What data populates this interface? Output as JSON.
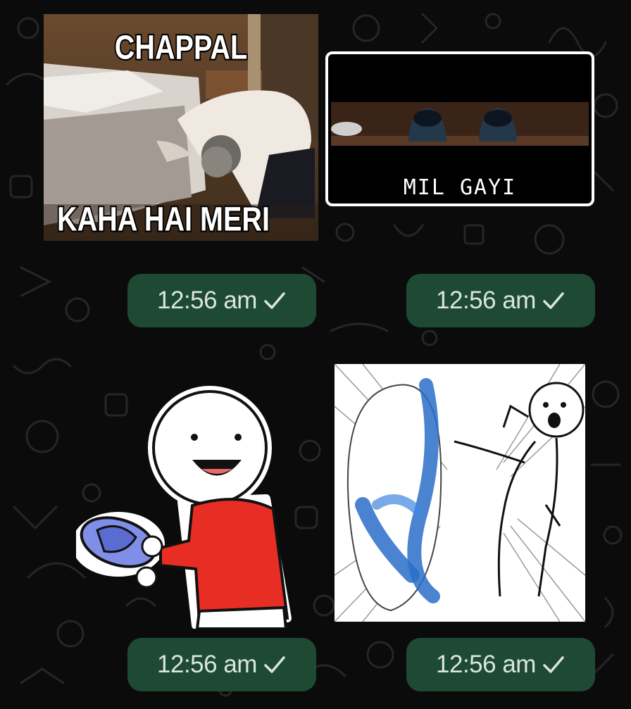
{
  "theme": {
    "background": "#0b0b0b",
    "bubble_color": "#1e4a34",
    "doodle_color": "#2a2a2a",
    "shirt_red": "#e82e24",
    "slipper_blue": "#7f8fe8",
    "slipper_blue_dark": "#2a6fc9"
  },
  "messages": [
    {
      "id": "sticker-1",
      "kind": "photo-meme",
      "top_text": "CHAPPAL",
      "bottom_text": "KAHA HAI MERI",
      "time": "12:56 am",
      "status_icon": "single-check-icon"
    },
    {
      "id": "sticker-2",
      "kind": "photo-meme",
      "caption": "MIL GAYI",
      "time": "12:56 am",
      "status_icon": "single-check-icon"
    },
    {
      "id": "sticker-3",
      "kind": "cartoon",
      "time": "12:56 am",
      "status_icon": "single-check-icon"
    },
    {
      "id": "sticker-4",
      "kind": "cartoon",
      "time": "12:56 am",
      "status_icon": "single-check-icon"
    }
  ]
}
